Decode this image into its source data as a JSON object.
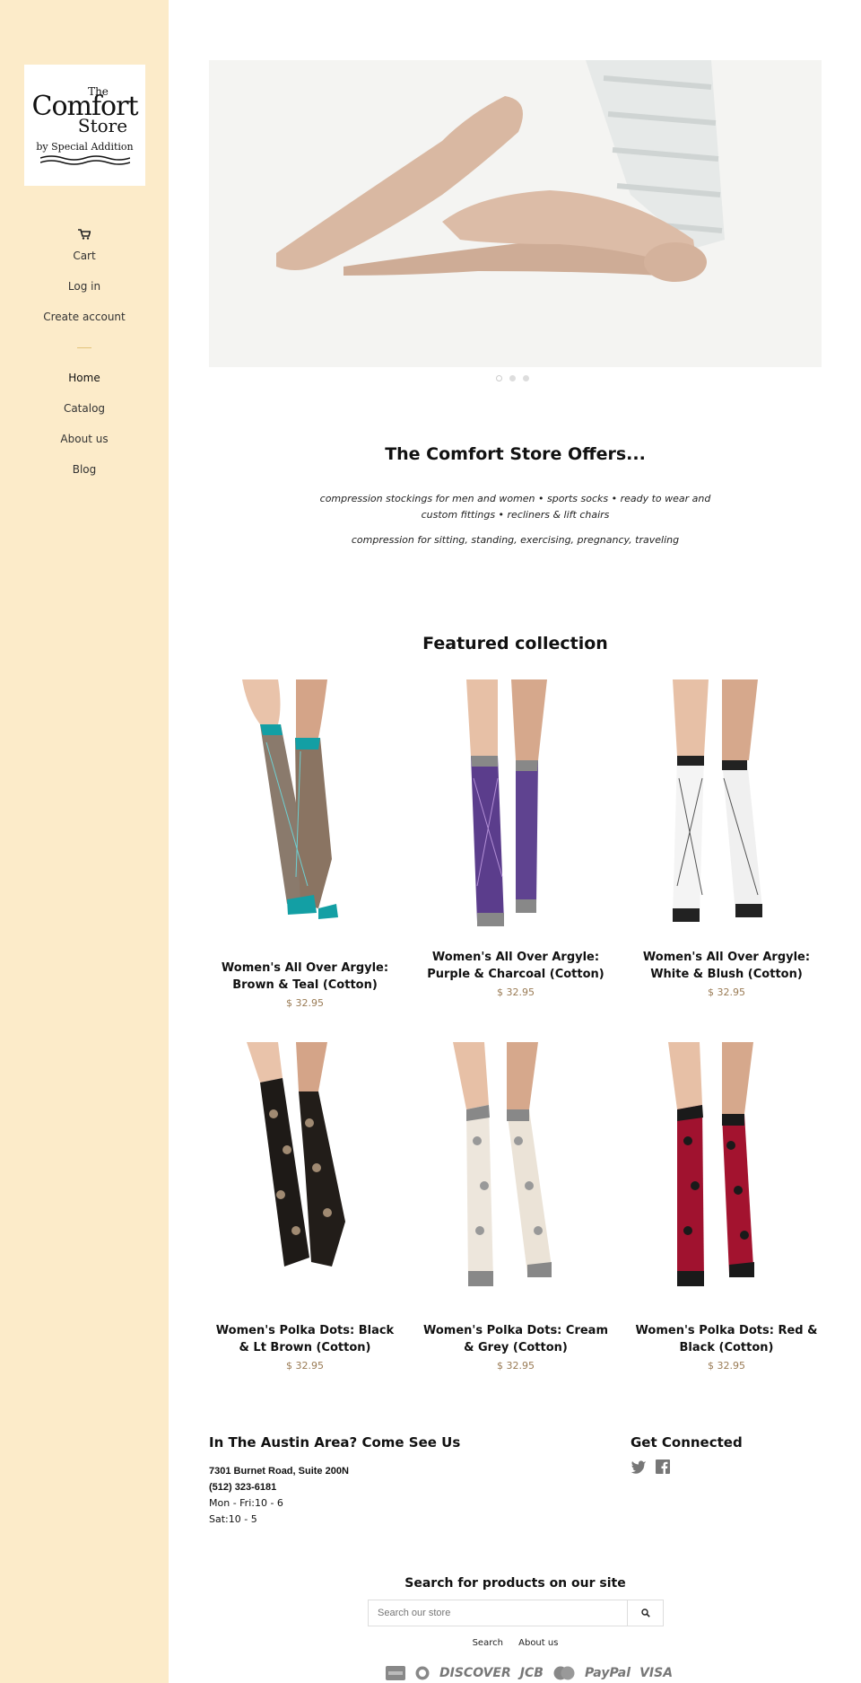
{
  "logo": {
    "line1": "The",
    "line2": "Comfort",
    "line3": "Store",
    "line4": "by Special Addition"
  },
  "sidebar": {
    "cart": "Cart",
    "login": "Log in",
    "create_account": "Create account",
    "nav": [
      "Home",
      "Catalog",
      "About us",
      "Blog"
    ]
  },
  "offers": {
    "title": "The Comfort Store Offers...",
    "line1": "compression stockings for men and women • sports socks • ready to wear and",
    "line2": "custom fittings • recliners & lift chairs",
    "line3": "compression for sitting, standing, exercising, pregnancy, traveling"
  },
  "featured": {
    "title": "Featured collection",
    "products": [
      {
        "name": "Women's All Over Argyle: Brown & Teal (Cotton)",
        "price": "$ 32.95"
      },
      {
        "name": "Women's All Over Argyle: Purple & Charcoal (Cotton)",
        "price": "$ 32.95"
      },
      {
        "name": "Women's All Over Argyle: White & Blush (Cotton)",
        "price": "$ 32.95"
      },
      {
        "name": "Women's Polka Dots: Black & Lt Brown (Cotton)",
        "price": "$ 32.95"
      },
      {
        "name": "Women's Polka Dots: Cream & Grey (Cotton)",
        "price": "$ 32.95"
      },
      {
        "name": "Women's Polka Dots: Red & Black (Cotton)",
        "price": "$ 32.95"
      }
    ]
  },
  "footer": {
    "visit_title": "In The Austin Area? Come See Us",
    "address": "7301 Burnet Road, Suite 200N",
    "phone": "(512) 323-6181",
    "hours1": "Mon - Fri:10 - 6",
    "hours2": "Sat:10 - 5",
    "connect_title": "Get Connected",
    "search_title": "Search for products on our site",
    "search_placeholder": "Search our store",
    "links": [
      "Search",
      "About us"
    ],
    "payments": [
      "DISCOVER",
      "JCB",
      "PayPal",
      "VISA"
    ]
  },
  "colors": {
    "sidebar_bg": "#fcebc9",
    "price": "#9a7b55",
    "divider": "#e2c27a"
  },
  "icons": [
    "cart-icon",
    "twitter-icon",
    "facebook-icon",
    "search-icon",
    "amex-icon",
    "diners-icon",
    "mastercard-icon"
  ]
}
